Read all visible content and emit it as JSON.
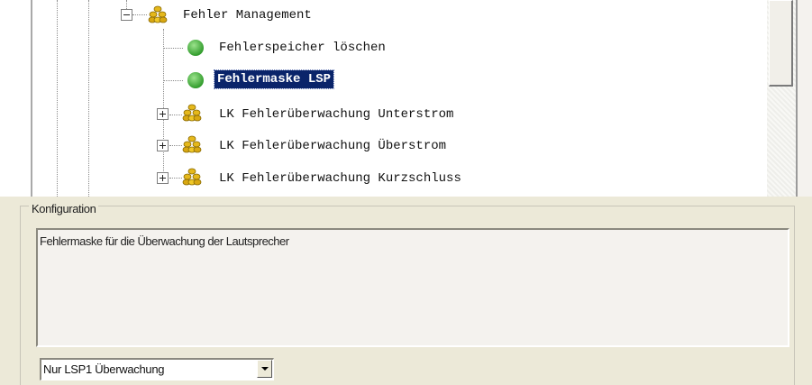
{
  "tree": {
    "parent": {
      "label": "Fehler Management",
      "icon": "coins-icon",
      "expanded": true
    },
    "items": [
      {
        "label": "Fehlerspeicher löschen",
        "icon": "green-status-icon"
      },
      {
        "label": "Fehlermaske LSP",
        "icon": "green-status-icon",
        "selected": true
      },
      {
        "label": "LK Fehlerüberwachung Unterstrom",
        "icon": "coins-icon",
        "expanded": false
      },
      {
        "label": "LK Fehlerüberwachung Überstrom",
        "icon": "coins-icon",
        "expanded": false
      },
      {
        "label": "LK Fehlerüberwachung Kurzschluss",
        "icon": "coins-icon",
        "expanded": false
      }
    ]
  },
  "config": {
    "title": "Konfiguration",
    "description": "Fehlermaske für die Überwachung der Lautsprecher",
    "select": {
      "value": "Nur LSP1 Überwachung"
    }
  },
  "colors": {
    "selection": "#0a246a",
    "panel": "#ece9d8",
    "status_green": "#44b33a"
  }
}
